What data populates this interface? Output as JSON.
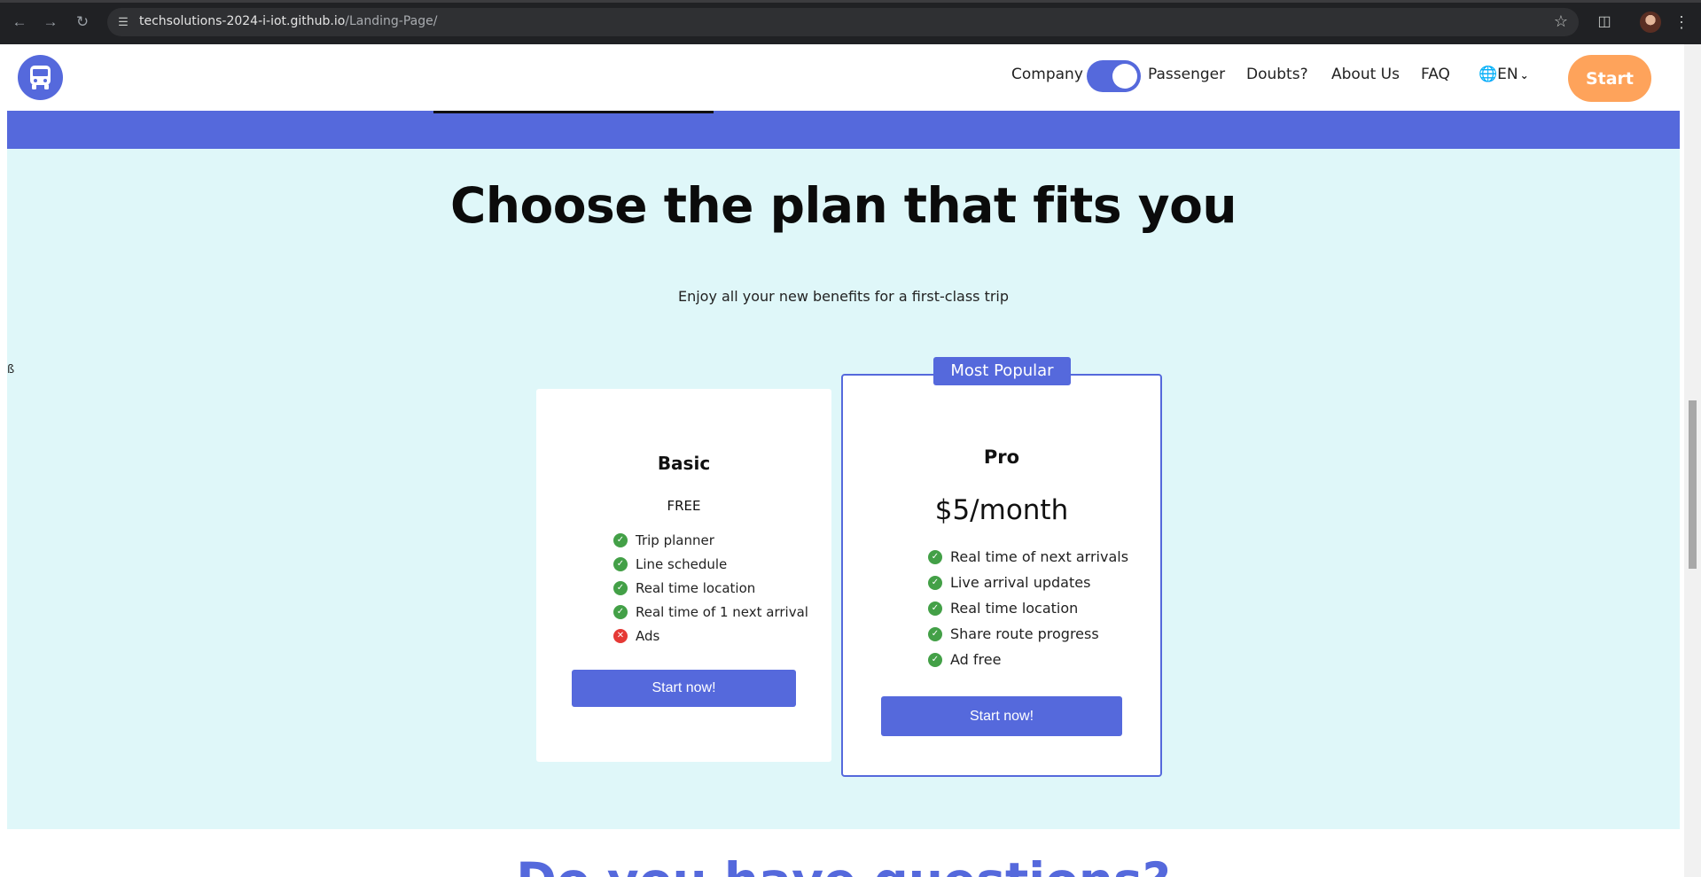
{
  "browser": {
    "url_host": "techsolutions-2024-i-iot.github.io",
    "url_path": "/Landing-Page/"
  },
  "header": {
    "company_label": "Company",
    "passenger_label": "Passenger",
    "nav": [
      "Doubts?",
      "About Us",
      "FAQ"
    ],
    "language": "EN",
    "start_label": "Start",
    "toggle_state": "passenger"
  },
  "stray_glyph": "ß",
  "pricing": {
    "title": "Choose the plan that fits you",
    "subtitle": "Enjoy all your new benefits for a first-class trip",
    "plans": [
      {
        "name": "Basic",
        "price": "FREE",
        "features": [
          {
            "text": "Trip planner",
            "included": true
          },
          {
            "text": "Line schedule",
            "included": true
          },
          {
            "text": "Real time location",
            "included": true
          },
          {
            "text": "Real time of 1 next arrival",
            "included": true
          },
          {
            "text": "Ads",
            "included": false
          }
        ],
        "cta": "Start now!"
      },
      {
        "badge": "Most Popular",
        "name": "Pro",
        "price": "$5/month",
        "features": [
          {
            "text": "Real time of next arrivals",
            "included": true
          },
          {
            "text": "Live arrival updates",
            "included": true
          },
          {
            "text": "Real time location",
            "included": true
          },
          {
            "text": "Share route progress",
            "included": true
          },
          {
            "text": "Ad free",
            "included": true
          }
        ],
        "cta": "Start now!"
      }
    ]
  },
  "next_section_title": "Do you have questions?",
  "colors": {
    "brand": "#5569dc",
    "accent": "#fea35b",
    "section_bg": "#dff7f9",
    "check": "#43a047",
    "cross": "#e53935"
  }
}
